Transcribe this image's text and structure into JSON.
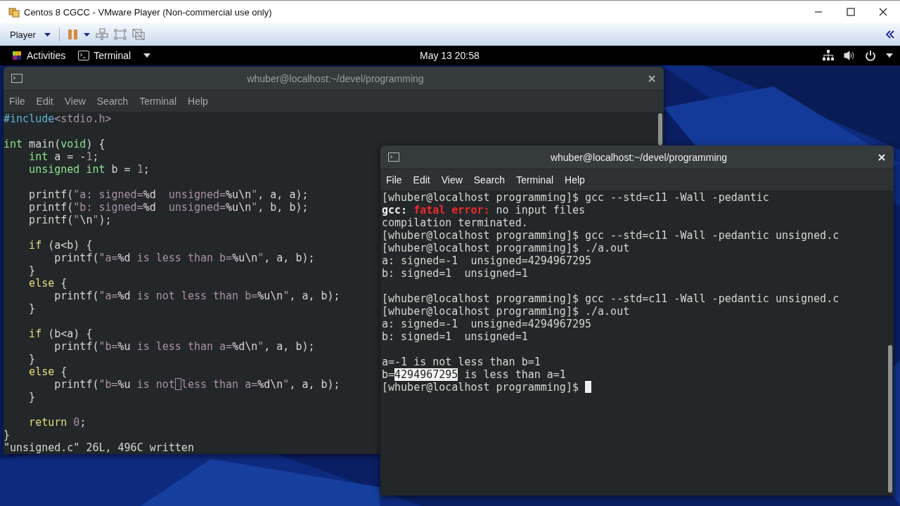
{
  "window": {
    "title": "Centos 8 CGCC - VMware Player (Non-commercial use only)"
  },
  "toolbar": {
    "player_menu": "Player"
  },
  "top_bar": {
    "activities": "Activities",
    "app_menu": "Terminal",
    "clock": "May 13  20:58"
  },
  "terminals": [
    {
      "kind": "editor",
      "title": "whuber@localhost:~/devel/programming",
      "focused": false,
      "menu": [
        "File",
        "Edit",
        "View",
        "Search",
        "Terminal",
        "Help"
      ],
      "blocks": [
        {
          "lines": [
            {
              "segments": [
                {
                  "text": "#include",
                  "kind": "preproc"
                },
                {
                  "text": "<stdio.h>",
                  "kind": "string"
                }
              ]
            }
          ]
        },
        {
          "lines": [
            {
              "segments": [
                {
                  "text": "int",
                  "kind": "type"
                },
                {
                  "text": " main(",
                  "kind": "plain"
                },
                {
                  "text": "void",
                  "kind": "type"
                },
                {
                  "text": ") {",
                  "kind": "plain"
                }
              ]
            },
            {
              "segments": [
                {
                  "text": "    int",
                  "kind": "type"
                },
                {
                  "text": " a = -",
                  "kind": "plain"
                },
                {
                  "text": "1",
                  "kind": "number"
                },
                {
                  "text": ";",
                  "kind": "plain"
                }
              ]
            },
            {
              "segments": [
                {
                  "text": "    unsigned int",
                  "kind": "type"
                },
                {
                  "text": " b = ",
                  "kind": "plain"
                },
                {
                  "text": "1",
                  "kind": "number"
                },
                {
                  "text": ";",
                  "kind": "plain"
                }
              ]
            }
          ]
        },
        {
          "lines": [
            {
              "segments": [
                {
                  "text": "    printf(",
                  "kind": "plain"
                },
                {
                  "text": "\"a: signed=",
                  "kind": "string"
                },
                {
                  "text": "%d",
                  "kind": "special"
                },
                {
                  "text": "  unsigned=",
                  "kind": "string"
                },
                {
                  "text": "%u\\n",
                  "kind": "special"
                },
                {
                  "text": "\"",
                  "kind": "string"
                },
                {
                  "text": ", a, a);",
                  "kind": "plain"
                }
              ]
            },
            {
              "segments": [
                {
                  "text": "    printf(",
                  "kind": "plain"
                },
                {
                  "text": "\"b: signed=",
                  "kind": "string"
                },
                {
                  "text": "%d",
                  "kind": "special"
                },
                {
                  "text": "  unsigned=",
                  "kind": "string"
                },
                {
                  "text": "%u\\n",
                  "kind": "special"
                },
                {
                  "text": "\"",
                  "kind": "string"
                },
                {
                  "text": ", b, b);",
                  "kind": "plain"
                }
              ]
            },
            {
              "segments": [
                {
                  "text": "    printf(",
                  "kind": "plain"
                },
                {
                  "text": "\"",
                  "kind": "string"
                },
                {
                  "text": "\\n",
                  "kind": "special"
                },
                {
                  "text": "\"",
                  "kind": "string"
                },
                {
                  "text": ");",
                  "kind": "plain"
                }
              ]
            }
          ]
        },
        {
          "lines": [
            {
              "segments": [
                {
                  "text": "    if",
                  "kind": "keyword"
                },
                {
                  "text": " (a<b) {",
                  "kind": "plain"
                }
              ]
            },
            {
              "segments": [
                {
                  "text": "        printf(",
                  "kind": "plain"
                },
                {
                  "text": "\"a=",
                  "kind": "string"
                },
                {
                  "text": "%d",
                  "kind": "special"
                },
                {
                  "text": " is less than b=",
                  "kind": "string"
                },
                {
                  "text": "%u\\n",
                  "kind": "special"
                },
                {
                  "text": "\"",
                  "kind": "string"
                },
                {
                  "text": ", a, b);",
                  "kind": "plain"
                }
              ]
            },
            {
              "segments": [
                {
                  "text": "    }",
                  "kind": "plain"
                }
              ]
            },
            {
              "segments": [
                {
                  "text": "    else",
                  "kind": "keyword"
                },
                {
                  "text": " {",
                  "kind": "plain"
                }
              ]
            },
            {
              "segments": [
                {
                  "text": "        printf(",
                  "kind": "plain"
                },
                {
                  "text": "\"a=",
                  "kind": "string"
                },
                {
                  "text": "%d",
                  "kind": "special"
                },
                {
                  "text": " is not less than b=",
                  "kind": "string"
                },
                {
                  "text": "%u\\n",
                  "kind": "special"
                },
                {
                  "text": "\"",
                  "kind": "string"
                },
                {
                  "text": ", a, b);",
                  "kind": "plain"
                }
              ]
            },
            {
              "segments": [
                {
                  "text": "    }",
                  "kind": "plain"
                }
              ]
            }
          ]
        },
        {
          "lines": [
            {
              "segments": [
                {
                  "text": "    if",
                  "kind": "keyword"
                },
                {
                  "text": " (b<a) {",
                  "kind": "plain"
                }
              ]
            },
            {
              "segments": [
                {
                  "text": "        printf(",
                  "kind": "plain"
                },
                {
                  "text": "\"b=",
                  "kind": "string"
                },
                {
                  "text": "%u",
                  "kind": "special"
                },
                {
                  "text": " is less than a=",
                  "kind": "string"
                },
                {
                  "text": "%d\\n",
                  "kind": "special"
                },
                {
                  "text": "\"",
                  "kind": "string"
                },
                {
                  "text": ", a, b);",
                  "kind": "plain"
                }
              ]
            },
            {
              "segments": [
                {
                  "text": "    }",
                  "kind": "plain"
                }
              ]
            },
            {
              "segments": [
                {
                  "text": "    else",
                  "kind": "keyword"
                },
                {
                  "text": " {",
                  "kind": "plain"
                }
              ]
            },
            {
              "segments": [
                {
                  "text": "        printf(",
                  "kind": "plain"
                },
                {
                  "text": "\"b=",
                  "kind": "string"
                },
                {
                  "text": "%u",
                  "kind": "special"
                },
                {
                  "text": " is not",
                  "kind": "string",
                  "cursor": true
                },
                {
                  "text": "less than a=",
                  "kind": "string"
                },
                {
                  "text": "%d\\n",
                  "kind": "special"
                },
                {
                  "text": "\"",
                  "kind": "string"
                },
                {
                  "text": ", a, b);",
                  "kind": "plain"
                }
              ]
            },
            {
              "segments": [
                {
                  "text": "    }",
                  "kind": "plain"
                }
              ]
            }
          ]
        },
        {
          "lines": [
            {
              "segments": [
                {
                  "text": "    return",
                  "kind": "keyword"
                },
                {
                  "text": " 0",
                  "kind": "number"
                },
                {
                  "text": ";",
                  "kind": "plain"
                }
              ]
            },
            {
              "segments": [
                {
                  "text": "}",
                  "kind": "plain"
                }
              ]
            },
            {
              "segments": [
                {
                  "text": "\"unsigned.c\" 26L, 496C written",
                  "kind": "plain"
                }
              ]
            }
          ]
        }
      ]
    },
    {
      "kind": "shell",
      "title": "whuber@localhost:~/devel/programming",
      "focused": true,
      "menu": [
        "File",
        "Edit",
        "View",
        "Search",
        "Terminal",
        "Help"
      ],
      "blocks": [
        {
          "lines": [
            {
              "segments": [
                {
                  "text": "[whuber@localhost programming]$ gcc --std=c11 -Wall -pedantic",
                  "kind": "plain"
                }
              ]
            },
            {
              "segments": [
                {
                  "text": "gcc:",
                  "kind": "bold"
                },
                {
                  "text": " fatal error:",
                  "kind": "error"
                },
                {
                  "text": " no input files",
                  "kind": "plain"
                }
              ]
            },
            {
              "segments": [
                {
                  "text": "compilation terminated.",
                  "kind": "plain"
                }
              ]
            },
            {
              "segments": [
                {
                  "text": "[whuber@localhost programming]$ gcc --std=c11 -Wall -pedantic unsigned.c",
                  "kind": "plain"
                }
              ]
            },
            {
              "segments": [
                {
                  "text": "[whuber@localhost programming]$ ./a.out",
                  "kind": "plain"
                }
              ]
            },
            {
              "segments": [
                {
                  "text": "a: signed=-1  unsigned=4294967295",
                  "kind": "plain"
                }
              ]
            },
            {
              "segments": [
                {
                  "text": "b: signed=1  unsigned=1",
                  "kind": "plain"
                }
              ]
            }
          ]
        },
        {
          "lines": [
            {
              "segments": [
                {
                  "text": "[whuber@localhost programming]$ gcc --std=c11 -Wall -pedantic unsigned.c",
                  "kind": "plain"
                }
              ]
            },
            {
              "segments": [
                {
                  "text": "[whuber@localhost programming]$ ./a.out",
                  "kind": "plain"
                }
              ]
            },
            {
              "segments": [
                {
                  "text": "a: signed=-1  unsigned=4294967295",
                  "kind": "plain"
                }
              ]
            },
            {
              "segments": [
                {
                  "text": "b: signed=1  unsigned=1",
                  "kind": "plain"
                }
              ]
            }
          ]
        },
        {
          "lines": [
            {
              "segments": [
                {
                  "text": "a=-1 is not less than b=1",
                  "kind": "plain"
                }
              ]
            },
            {
              "segments": [
                {
                  "text": "b=",
                  "kind": "plain"
                },
                {
                  "text": "4294967295",
                  "kind": "selected"
                },
                {
                  "text": " is less than a=1",
                  "kind": "plain"
                }
              ]
            },
            {
              "segments": [
                {
                  "text": "[whuber@localhost programming]$",
                  "kind": "plain",
                  "cursor": true
                }
              ]
            }
          ]
        }
      ]
    }
  ]
}
